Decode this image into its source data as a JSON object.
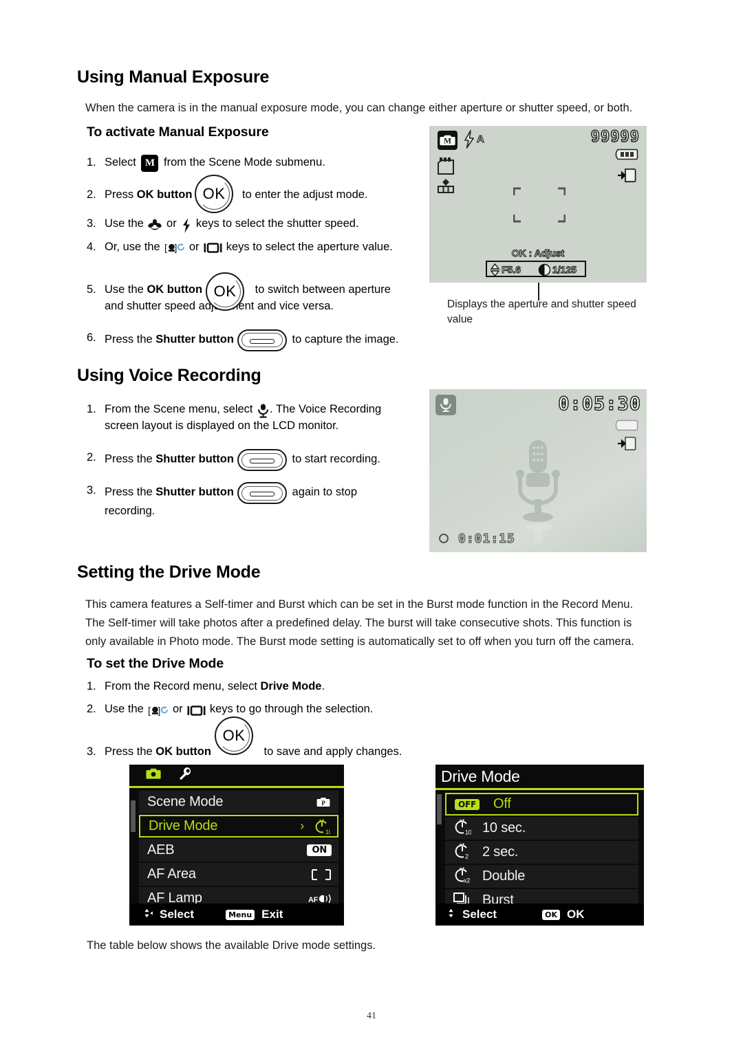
{
  "page": {
    "number": "41"
  },
  "manual_exposure": {
    "heading": "Using Manual Exposure",
    "intro": "When the camera is in the manual exposure mode, you can change either aperture or shutter speed, or both.",
    "subheading": "To activate Manual Exposure",
    "steps": [
      {
        "num": "1.",
        "pre": "Select ",
        "post": " from the Scene Mode submenu."
      },
      {
        "num": "2.",
        "pre": "Press ",
        "bold": "OK button",
        "post": " to enter the adjust mode."
      },
      {
        "num": "3.",
        "pre": "Use the ",
        "mid": " or ",
        "post": " keys to select the shutter speed."
      },
      {
        "num": "4.",
        "pre": "Or, use the ",
        "mid": " or ",
        "post": " keys to select the aperture value."
      },
      {
        "num": "5.",
        "pre": "Use the ",
        "bold": "OK button",
        "post": " to switch between aperture and shutter speed adjustment and vice versa."
      },
      {
        "num": "6.",
        "pre": "Press the ",
        "bold": "Shutter button",
        "post": " to capture the image."
      }
    ],
    "caption": "Displays the aperture and shutter speed value",
    "lcd": {
      "mode_badge": "M",
      "flash_label": "A",
      "shots_remaining": "99999",
      "adjust_hint": "OK : Adjust",
      "aperture": "F5.6",
      "shutter": "1/125"
    }
  },
  "voice_recording": {
    "heading": "Using Voice Recording",
    "steps": [
      {
        "num": "1.",
        "pre": "From the Scene menu, select ",
        "post": ". The Voice Recording screen layout is displayed on the LCD monitor."
      },
      {
        "num": "2.",
        "pre": "Press the ",
        "bold": "Shutter button",
        "post": " to start recording."
      },
      {
        "num": "3.",
        "pre": "Press the ",
        "bold": "Shutter button",
        "post": " again to stop recording."
      }
    ],
    "lcd": {
      "remaining_time": "0:05:30",
      "elapsed_time": "0:01:15"
    }
  },
  "drive_mode": {
    "heading": "Setting the Drive Mode",
    "intro": "This camera features a Self-timer and Burst which can be set in the Burst mode function in the Record Menu. The Self-timer will take photos after a predefined delay. The burst will take consecutive shots. This function is only available in Photo mode. The Burst mode setting is automatically set to off when you turn off the camera.",
    "subheading": "To set the Drive Mode",
    "steps": [
      {
        "num": "1.",
        "pre": "From the Record menu, select ",
        "bold": "Drive Mode",
        "post": "."
      },
      {
        "num": "2.",
        "pre": "Use the ",
        "mid": " or ",
        "post": " keys to go through the selection."
      },
      {
        "num": "3.",
        "pre": "Press the ",
        "bold": "OK button",
        "post": " to save and apply changes."
      }
    ],
    "closing": "The table below shows the available Drive mode settings.",
    "record_menu": {
      "rows": [
        {
          "label": "Scene Mode",
          "value_icon": "program-mode-icon",
          "value_text": "P"
        },
        {
          "label": "Drive Mode",
          "value_icon": "self-timer-10-icon",
          "value_text": "",
          "selected": true,
          "arrow": "›"
        },
        {
          "label": "AEB",
          "value_icon": "on-chip",
          "value_text": "ON"
        },
        {
          "label": "AF Area",
          "value_icon": "af-area-icon",
          "value_text": ""
        },
        {
          "label": "AF Lamp",
          "value_icon": "af-lamp-icon",
          "value_text": "AF"
        }
      ],
      "footer_select": "Select",
      "footer_menu_chip": "Menu",
      "footer_exit": "Exit"
    },
    "drive_menu": {
      "title": "Drive Mode",
      "rows": [
        {
          "label": "Off",
          "icon": "off-chip",
          "selected": true
        },
        {
          "label": "10 sec.",
          "icon": "self-timer-10-icon",
          "selected": false
        },
        {
          "label": "2 sec.",
          "icon": "self-timer-2-icon",
          "selected": false
        },
        {
          "label": "Double",
          "icon": "self-timer-double-icon",
          "selected": false
        },
        {
          "label": "Burst",
          "icon": "burst-icon",
          "selected": false
        }
      ],
      "footer_select": "Select",
      "footer_ok_chip": "OK",
      "footer_ok": "OK"
    }
  },
  "colors": {
    "menu_accent": "#b6e013",
    "menu_bg": "#0b0b0b",
    "lcd_bg": "#ccd4cc"
  }
}
